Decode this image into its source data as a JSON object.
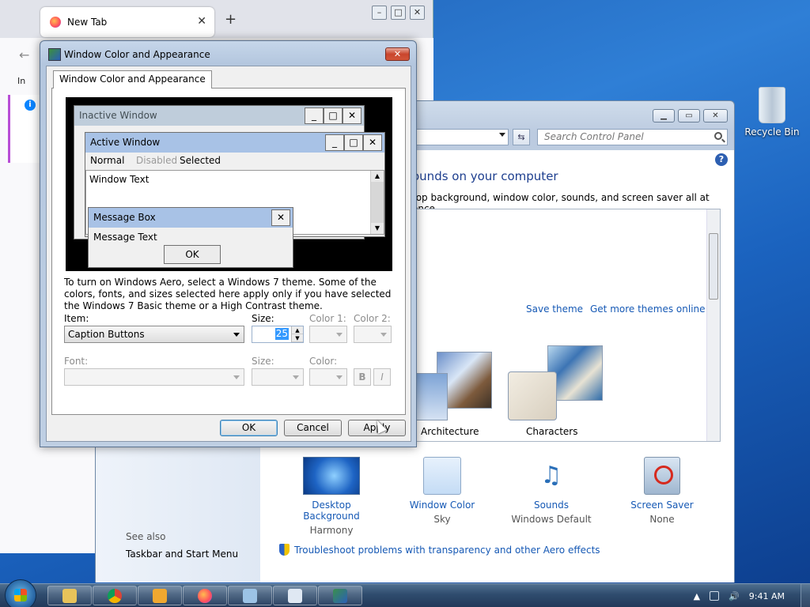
{
  "firefox": {
    "tab_title": "New Tab",
    "tab_close": "✕",
    "new_tab": "+",
    "back": "←",
    "sidebar_label": "In"
  },
  "control_panel": {
    "search_placeholder": "Search Control Panel",
    "help": "?",
    "heading": "ounds on your computer",
    "description": "top background, window color, sounds, and screen saver all at once.",
    "save_theme": "Save theme",
    "get_more_themes": "Get more themes online",
    "themes": [
      {
        "label": "Architecture"
      },
      {
        "label": "Characters"
      }
    ],
    "bottom_items": [
      {
        "title": "Desktop Background",
        "subtitle": "Harmony",
        "icon": "desktop-background-icon"
      },
      {
        "title": "Window Color",
        "subtitle": "Sky",
        "icon": "window-color-icon"
      },
      {
        "title": "Sounds",
        "subtitle": "Windows Default",
        "icon": "sounds-icon"
      },
      {
        "title": "Screen Saver",
        "subtitle": "None",
        "icon": "screen-saver-icon"
      }
    ],
    "see_also": "See also",
    "taskbar_link": "Taskbar and Start Menu",
    "troubleshoot": "Troubleshoot problems with transparency and other Aero effects"
  },
  "dialog": {
    "title": "Window Color and Appearance",
    "close": "✕",
    "tab": "Window Color and Appearance",
    "preview": {
      "inactive_title": "Inactive Window",
      "active_title": "Active Window",
      "menu_normal": "Normal",
      "menu_disabled": "Disabled",
      "menu_selected": "Selected",
      "window_text": "Window Text",
      "msgbox_title": "Message Box",
      "msgbox_text": "Message Text",
      "msgbox_ok": "OK"
    },
    "explanation": "To turn on Windows Aero, select a Windows 7 theme.  Some of the colors, fonts, and sizes selected here apply only if you have selected the Windows 7 Basic theme or a High Contrast theme.",
    "item_label": "Item:",
    "item_value": "Caption Buttons",
    "size_label": "Size:",
    "size_value": "25",
    "color1_label": "Color 1:",
    "color2_label": "Color 2:",
    "font_label": "Font:",
    "font_size_label": "Size:",
    "font_color_label": "Color:",
    "bold": "B",
    "italic": "I",
    "ok": "OK",
    "cancel": "Cancel",
    "apply": "Apply"
  },
  "desktop": {
    "recycle_bin": "Recycle Bin"
  },
  "taskbar": {
    "apps": [
      {
        "icon": "explorer-icon",
        "color": "#e8c35a"
      },
      {
        "icon": "chrome-icon",
        "color": "#db4437"
      },
      {
        "icon": "media-player-icon",
        "color": "#f0a830"
      },
      {
        "icon": "firefox-icon",
        "color": "#ff7139"
      },
      {
        "icon": "remote-desktop-icon",
        "color": "#9cc3e6"
      },
      {
        "icon": "window-icon",
        "color": "#dfe8f3"
      },
      {
        "icon": "personalization-icon",
        "color": "#3a8f4c"
      }
    ],
    "clock": "9:41 AM"
  },
  "colors": {
    "link": "#1659b5",
    "active_caption": "#a8c2e6",
    "inactive_caption": "#bfcddb",
    "selection": "#3399ff"
  }
}
